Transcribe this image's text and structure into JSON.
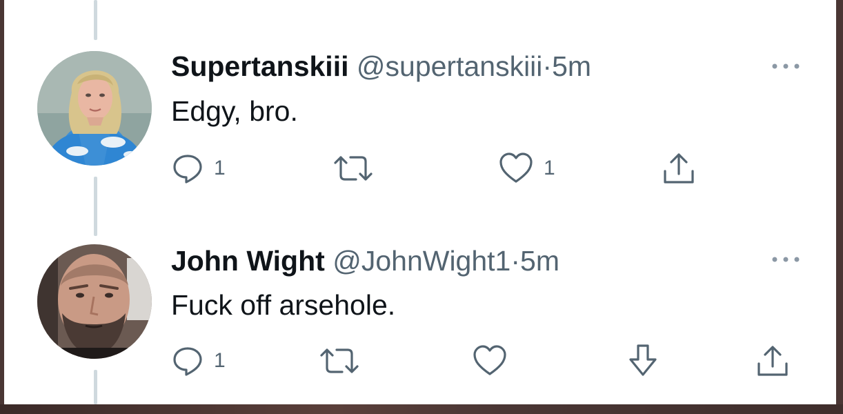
{
  "tweets": [
    {
      "display_name": "Supertanskiii",
      "handle": "@supertanskiii",
      "separator": "·",
      "time": "5m",
      "text": "Edgy, bro.",
      "reply_count": "1",
      "retweet_count": "",
      "like_count": "1",
      "icons": [
        "reply-icon",
        "retweet-icon",
        "like-icon",
        "share-icon",
        "more-icon"
      ]
    },
    {
      "display_name": "John Wight",
      "handle": "@JohnWight1",
      "separator": "·",
      "time": "5m",
      "text": "Fuck off arsehole.",
      "reply_count": "1",
      "retweet_count": "",
      "like_count": "",
      "icons": [
        "reply-icon",
        "retweet-icon",
        "like-icon",
        "downvote-icon",
        "share-icon",
        "more-icon"
      ]
    }
  ],
  "colors": {
    "text_primary": "#0f1419",
    "text_secondary": "#536471",
    "thread_line": "#cfd9de",
    "background": "#ffffff"
  }
}
